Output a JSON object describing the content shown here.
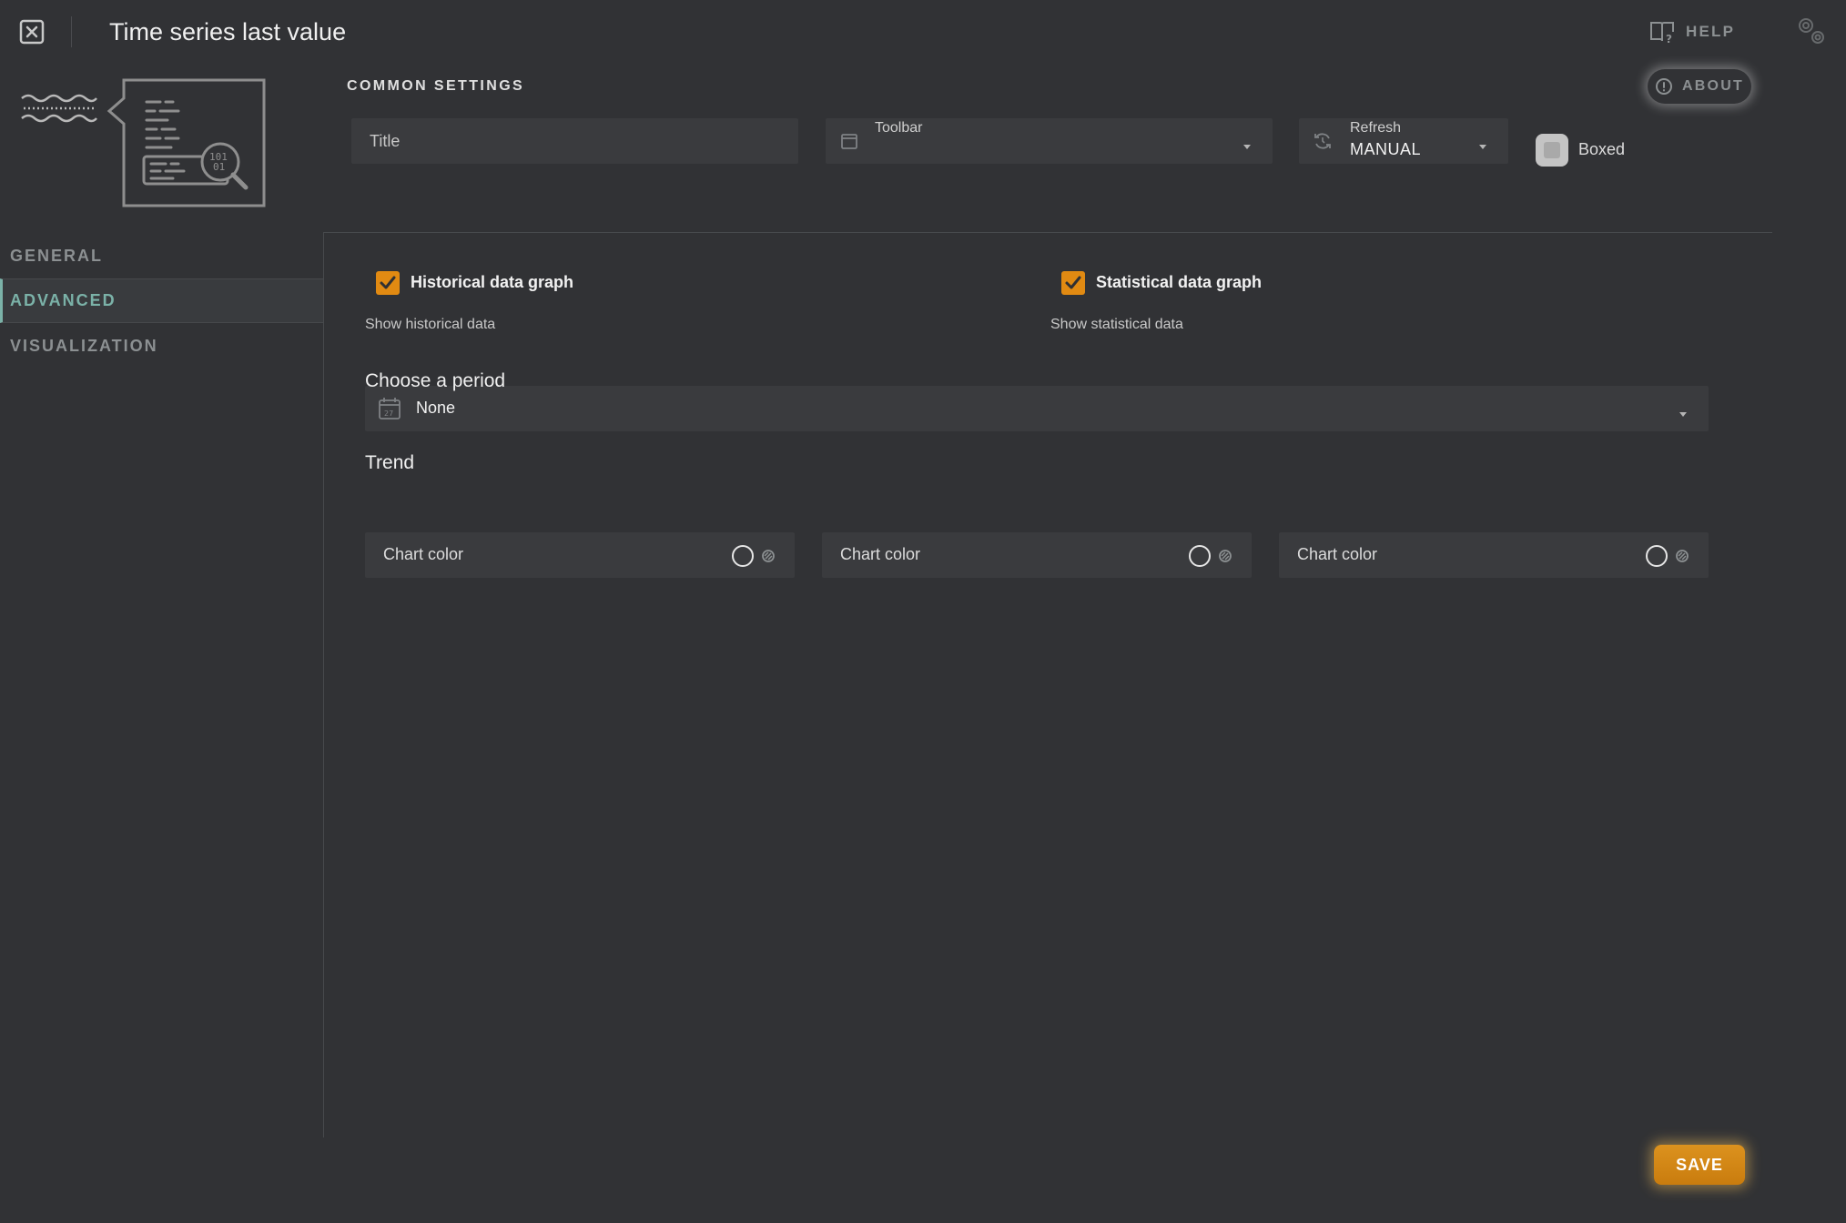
{
  "window": {
    "title": "Time series last value",
    "close_icon": "close-icon",
    "help_label": "HELP",
    "help_icon": "book-help-icon",
    "settings_icon": "gears-icon"
  },
  "common_settings": {
    "heading": "COMMON SETTINGS",
    "about_label": "ABOUT",
    "about_icon": "info-icon",
    "title_field": {
      "placeholder": "Title",
      "value": ""
    },
    "toolbar_field": {
      "label": "Toolbar",
      "value": "",
      "icon": "toolbar-icon"
    },
    "refresh_field": {
      "label": "Refresh",
      "value": "MANUAL",
      "icon": "refresh-icon"
    },
    "boxed": {
      "label": "Boxed",
      "checked": false
    }
  },
  "sidebar": {
    "items": [
      {
        "label": "GENERAL",
        "active": false
      },
      {
        "label": "ADVANCED",
        "active": true
      },
      {
        "label": "VISUALIZATION",
        "active": false
      }
    ]
  },
  "advanced": {
    "historical": {
      "label": "Historical data graph",
      "help": "Show historical data",
      "checked": true
    },
    "statistical": {
      "label": "Statistical data graph",
      "help": "Show statistical data",
      "checked": true
    },
    "period": {
      "label": "Choose a period",
      "value": "None",
      "icon": "calendar-icon"
    },
    "trend": {
      "label": "Trend"
    },
    "chart_colors": [
      {
        "label": "Chart color"
      },
      {
        "label": "Chart color"
      },
      {
        "label": "Chart color"
      }
    ]
  },
  "footer": {
    "save_label": "SAVE"
  },
  "colors": {
    "background": "#313235",
    "field": "#3a3b3e",
    "accent_orange": "#e18a12",
    "accent_teal": "#7bb2a8",
    "muted_text": "#8c9092"
  }
}
